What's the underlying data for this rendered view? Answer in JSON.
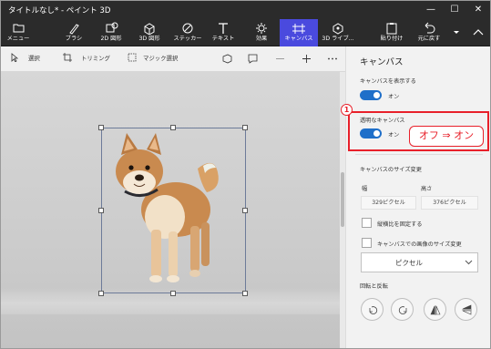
{
  "window": {
    "title": "タイトルなし* - ペイント 3D",
    "controls": [
      "—",
      "☐",
      "✕"
    ]
  },
  "ribbon": {
    "menu_label": "メニュー",
    "tools": [
      {
        "label": "ブラシ",
        "icon": "brush-icon"
      },
      {
        "label": "2D 図形",
        "icon": "2d-shapes-icon"
      },
      {
        "label": "3D 図形",
        "icon": "3d-shapes-icon"
      },
      {
        "label": "ステッカー",
        "icon": "sticker-icon"
      },
      {
        "label": "テキスト",
        "icon": "text-icon"
      },
      {
        "label": "効果",
        "icon": "effects-icon"
      },
      {
        "label": "キャンバス",
        "icon": "canvas-icon",
        "active": true
      },
      {
        "label": "3D ライブ...",
        "icon": "3d-library-icon"
      }
    ],
    "paste_label": "貼り付け",
    "undo_label": "元に戻す"
  },
  "toolbar": {
    "select_label": "選択",
    "crop_label": "トリミング",
    "magic_select_label": "マジック選択"
  },
  "panel": {
    "title": "キャンバス",
    "show_canvas_label": "キャンバスを表示する",
    "show_canvas_state": "オン",
    "transparent_label": "透明なキャンバス",
    "transparent_state": "オン",
    "resize_heading": "キャンバスのサイズ変更",
    "width_label": "幅",
    "height_label": "高さ",
    "width_value": "329ピクセル",
    "height_value": "376ピクセル",
    "lock_aspect_label": "縦横比を固定する",
    "resize_image_label": "キャンバスでの画像のサイズ変更",
    "unit_value": "ピクセル",
    "rotate_heading": "回転と反転"
  },
  "annotation": {
    "number": "1",
    "label": "オフ ⇒ オン"
  },
  "colors": {
    "ribbon_bg": "#2b2b2b",
    "active_tab": "#4a4ade",
    "toggle_on": "#1f6fc9",
    "annotation_red": "#e8202a"
  }
}
